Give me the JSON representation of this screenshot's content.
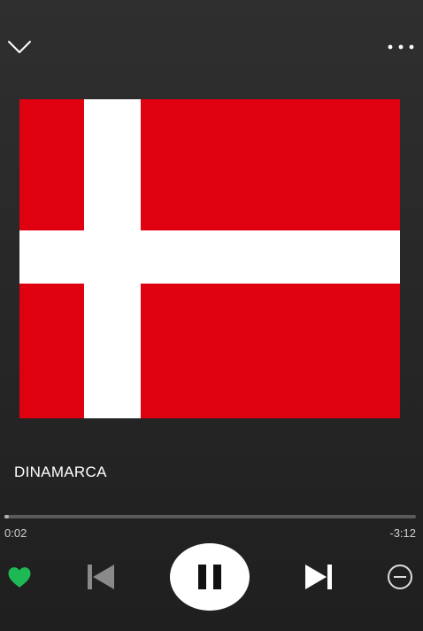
{
  "header": {
    "collapse_icon": "chevron-down-icon",
    "more_icon": "more-horizontal-icon"
  },
  "artwork": {
    "description_icon": "denmark-flag",
    "colors": {
      "red": "#df0010",
      "white": "#ffffff"
    }
  },
  "track": {
    "title": "DINAMARCA"
  },
  "playback": {
    "elapsed": "0:02",
    "remaining": "-3:12",
    "progress_fraction": 0.01,
    "state": "playing"
  },
  "controls": {
    "like_icon": "heart-icon",
    "like_color": "#1db954",
    "prev_icon": "skip-previous-icon",
    "pause_icon": "pause-icon",
    "next_icon": "skip-next-icon",
    "hide_icon": "minus-circle-icon"
  },
  "theme": {
    "background": "#2a2a2a",
    "accent": "#1db954",
    "progress_track": "#5a5a5a",
    "progress_fill": "#b3b3b3"
  }
}
